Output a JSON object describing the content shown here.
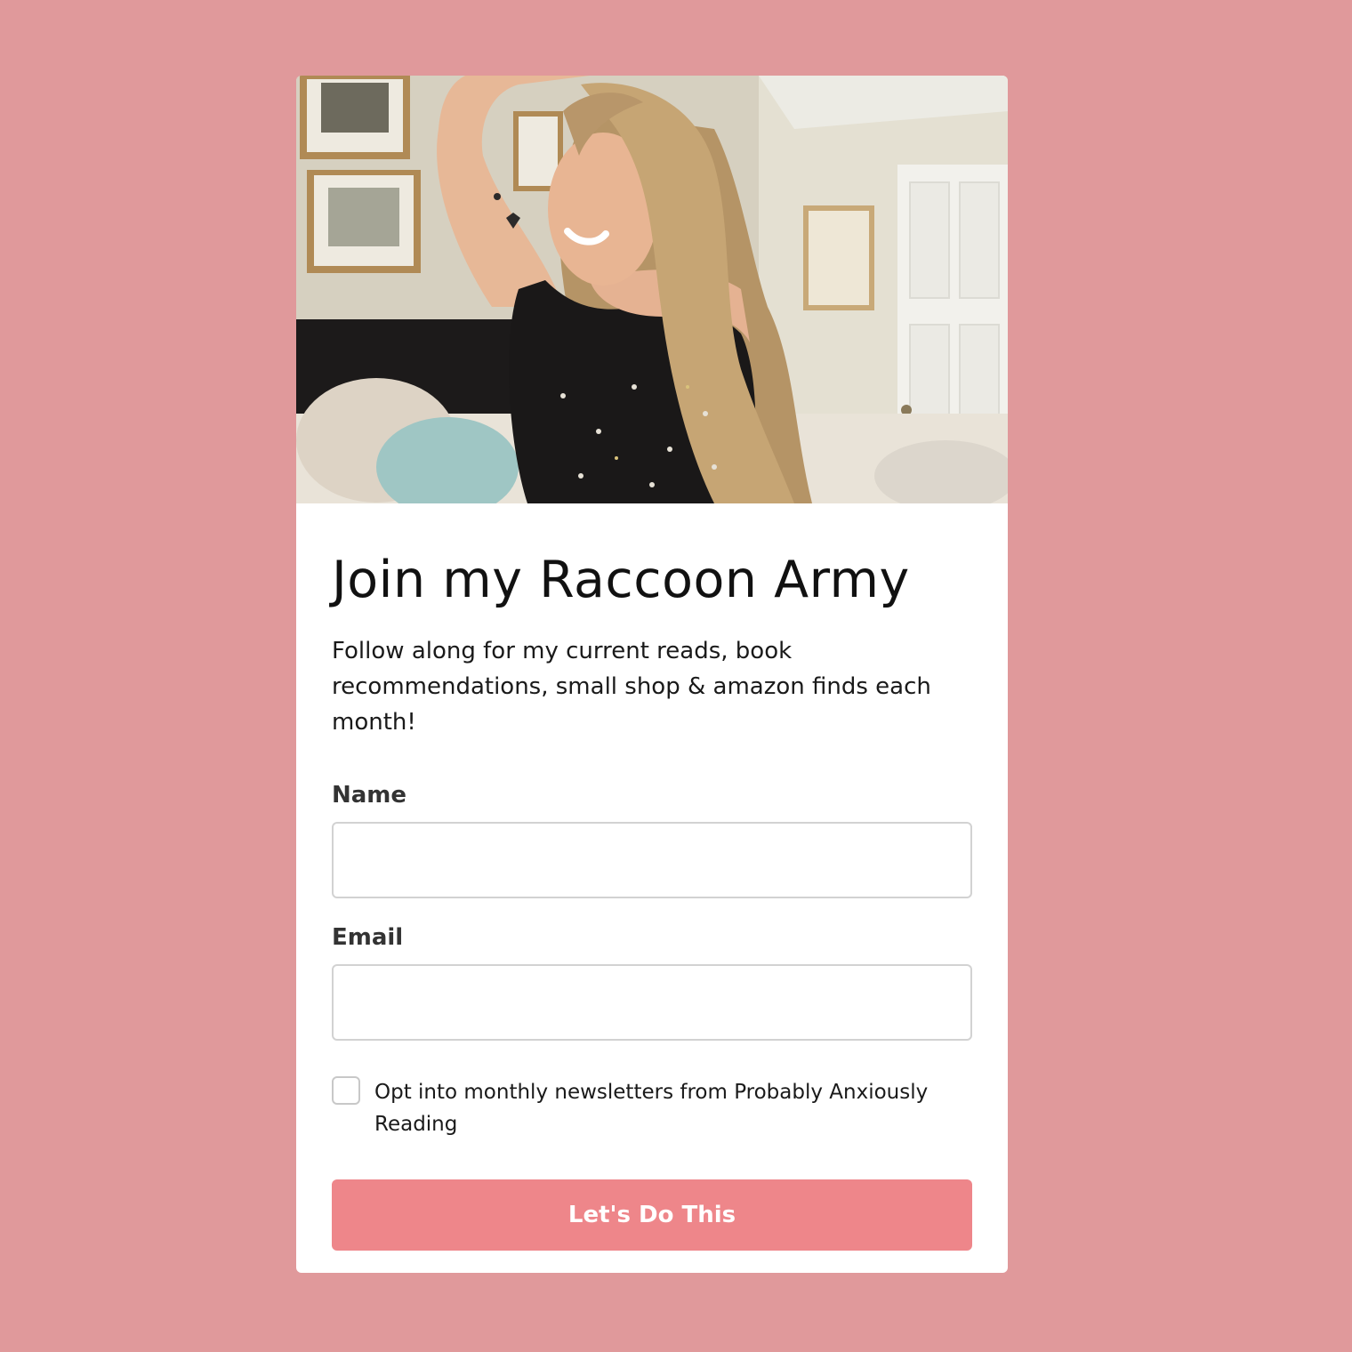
{
  "colors": {
    "page_background": "#e0999b",
    "card_background": "#ffffff",
    "button_background": "#ee868a",
    "button_text": "#ffffff",
    "title_text": "#111111",
    "label_text": "#333333",
    "input_border": "#d2d2d2"
  },
  "hero": {
    "description_icon": "photo-woman-bedroom"
  },
  "form": {
    "title": "Join my Raccoon Army",
    "subtitle": "Follow along for my current reads, book recommendations, small shop & amazon finds each month!",
    "name_label": "Name",
    "name_value": "",
    "name_placeholder": "",
    "email_label": "Email",
    "email_value": "",
    "email_placeholder": "",
    "optin_label": "Opt into monthly newsletters from Probably Anxiously Reading",
    "optin_checked": false,
    "submit_label": "Let's Do This"
  }
}
